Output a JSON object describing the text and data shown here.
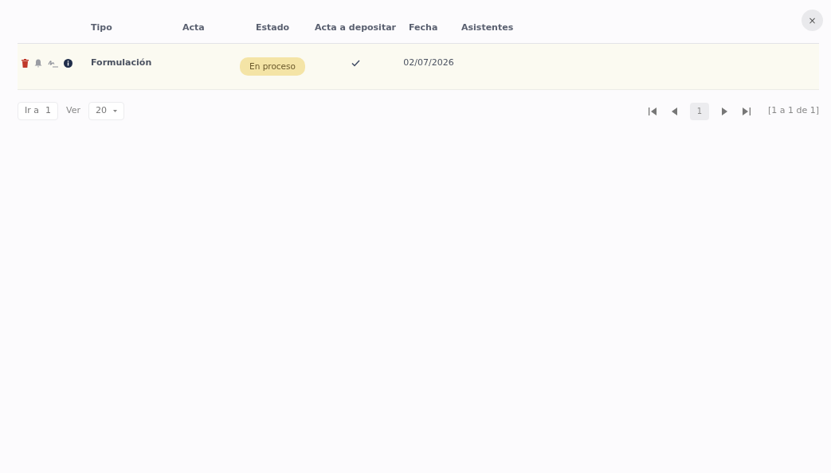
{
  "close": "×",
  "table": {
    "columns": [
      "Tipo",
      "Acta",
      "Estado",
      "Acta a depositar",
      "Fecha",
      "Asistentes"
    ],
    "rows": [
      {
        "tipo": "Formulación",
        "acta": "",
        "estado": "En proceso",
        "acta_a_depositar": true,
        "fecha": "02/07/2026"
      }
    ]
  },
  "pager": {
    "goto_label": "Ir a",
    "goto_value": "1",
    "view_label": "Ver",
    "view_value": "20",
    "current_page": "1",
    "summary": "[1 a 1 de 1]"
  }
}
